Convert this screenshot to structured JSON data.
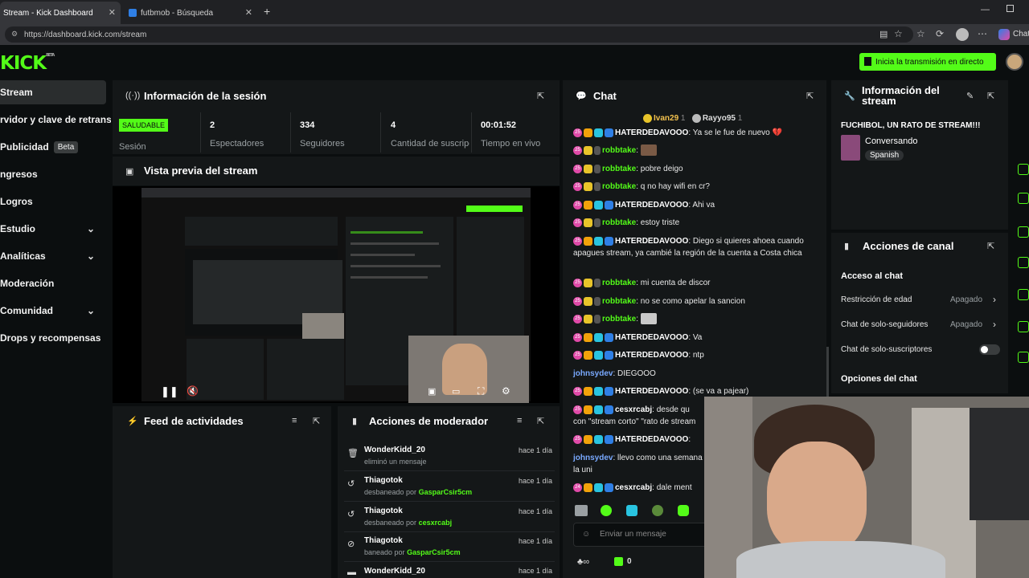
{
  "browser": {
    "tabs": [
      {
        "title": "Stream - Kick Dashboard"
      },
      {
        "title": "futbmob - Búsqueda"
      }
    ],
    "url": "https://dashboard.kick.com/stream",
    "chat_label": "Chat"
  },
  "header": {
    "logo": "KICK",
    "logo_beta": "BETA",
    "go_live": "Inicia la transmisión en directo"
  },
  "sidebar": {
    "items": [
      {
        "label": "Stream"
      },
      {
        "label": "rvidor y clave de retransm"
      },
      {
        "label": "Publicidad",
        "badge": "Beta"
      },
      {
        "label": "ngresos"
      },
      {
        "label": "Logros"
      },
      {
        "label": "Estudio"
      },
      {
        "label": "Analíticas"
      },
      {
        "label": "Moderación"
      },
      {
        "label": "Comunidad"
      },
      {
        "label": "Drops y recompensas"
      }
    ]
  },
  "session": {
    "title": "Información de la sesión",
    "status": "SALUDABLE",
    "status_label": "Sesión",
    "viewers": "2",
    "viewers_label": "Espectadores",
    "followers": "334",
    "followers_label": "Seguidores",
    "subs": "4",
    "subs_label": "Cantidad de suscripciones",
    "uptime": "00:01:52",
    "uptime_label": "Tiempo en vivo"
  },
  "preview": {
    "title": "Vista previa del stream"
  },
  "feed": {
    "title": "Feed de actividades"
  },
  "mod_actions": {
    "title": "Acciones de moderador",
    "items": [
      {
        "user": "WonderKidd_20",
        "desc": "eliminó un mensaje",
        "by": "",
        "time": "hace 1 día"
      },
      {
        "user": "Thiagotok",
        "desc": "desbaneado por",
        "by": "GasparCsir5cm",
        "time": "hace 1 día"
      },
      {
        "user": "Thiagotok",
        "desc": "desbaneado por",
        "by": "cesxrcabj",
        "time": "hace 1 día"
      },
      {
        "user": "Thiagotok",
        "desc": "baneado por",
        "by": "GasparCsir5cm",
        "time": "hace 1 día"
      },
      {
        "user": "WonderKidd_20",
        "desc": "",
        "by": "",
        "time": "hace 1 día"
      }
    ]
  },
  "chat": {
    "title": "Chat",
    "pinned": [
      {
        "name": "Ivan29",
        "count": "1"
      },
      {
        "name": "Rayyo95",
        "count": "1"
      }
    ],
    "messages": [
      {
        "user": "HATERDEDAVOOO",
        "text": "Ya se le fue de nuevo 💔"
      },
      {
        "user": "robbtake",
        "text": ""
      },
      {
        "user": "robbtake",
        "text": "pobre deigo"
      },
      {
        "user": "robbtake",
        "text": "q no hay wifi en cr?"
      },
      {
        "user": "HATERDEDAVOOO",
        "text": "Ahi va"
      },
      {
        "user": "robbtake",
        "text": "estoy triste"
      },
      {
        "user": "HATERDEDAVOOO",
        "text": "Diego si quieres ahoea cuando apagues stream, ya cambié la región de la cuenta a Costa chica"
      },
      {
        "user": "robbtake",
        "text": "mi cuenta de discor"
      },
      {
        "user": "robbtake",
        "text": "no se como apelar la sancion"
      },
      {
        "user": "robbtake",
        "text": ""
      },
      {
        "user": "HATERDEDAVOOO",
        "text": "Va"
      },
      {
        "user": "HATERDEDAVOOO",
        "text": "ntp"
      },
      {
        "user": "johnsydev",
        "text": "DIEGOOO"
      },
      {
        "user": "HATERDEDAVOOO",
        "text": "(se va a pajear)"
      },
      {
        "user": "cesxrcabj",
        "text": "desde qu"
      },
      {
        "user": "",
        "text": "con \"stream corto\" \"rato de stream"
      },
      {
        "user": "HATERDEDAVOOO",
        "text": ""
      },
      {
        "user": "johnsydev",
        "text": "llevo como una semana"
      },
      {
        "user": "",
        "text": "la uni"
      },
      {
        "user": "cesxrcabj",
        "text": "dale ment"
      }
    ],
    "input_placeholder": "Enviar un mensaje",
    "footer_count": "0"
  },
  "stream_info": {
    "title": "Información del stream",
    "stream_title": "FUCHIBOL, UN RATO DE STREAM!!!",
    "category": "Conversando",
    "language": "Spanish"
  },
  "channel_actions": {
    "title": "Acciones de canal",
    "section": "Acceso al chat",
    "rows": [
      {
        "label": "Restricción de edad",
        "value": "Apagado"
      },
      {
        "label": "Chat de solo-seguidores",
        "value": "Apagado"
      },
      {
        "label": "Chat de solo-suscriptores",
        "value": ""
      }
    ],
    "section2": "Opciones del chat"
  },
  "colors": {
    "accent": "#53fc18",
    "bg": "#0b0e0f",
    "panel": "#141718"
  }
}
